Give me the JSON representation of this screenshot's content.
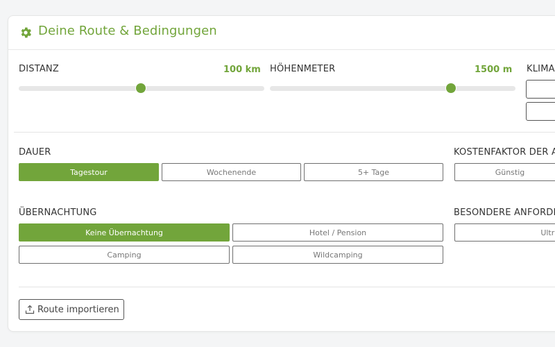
{
  "header": {
    "title": "Deine Route & Bedingungen"
  },
  "sliders": {
    "distance": {
      "label": "DISTANZ",
      "value": "100 km",
      "fraction": 0.5
    },
    "elevation": {
      "label": "HÖHENMETER",
      "value": "1500 m",
      "fraction": 0.74
    }
  },
  "climate": {
    "label": "KLIMA"
  },
  "duration": {
    "label": "DAUER",
    "options": [
      "Tagestour",
      "Wochenende",
      "5+ Tage"
    ],
    "selected": "Tagestour"
  },
  "cost": {
    "label": "KOSTENFAKTOR DER A",
    "options": [
      "Günstig"
    ]
  },
  "overnight": {
    "label": "ÜBERNACHTUNG",
    "options": [
      "Keine Übernachtung",
      "Hotel / Pension",
      "Camping",
      "Wildcamping"
    ],
    "selected": "Keine Übernachtung"
  },
  "special": {
    "label": "BESONDERE ANFORDE",
    "options": [
      "Ultra"
    ]
  },
  "footer": {
    "import_label": "Route importieren"
  },
  "colors": {
    "accent": "#72a53b",
    "track": "#e7e7e7",
    "border": "#6f6f6f"
  },
  "icons": {
    "header": "gear-icon",
    "import": "upload-icon"
  }
}
